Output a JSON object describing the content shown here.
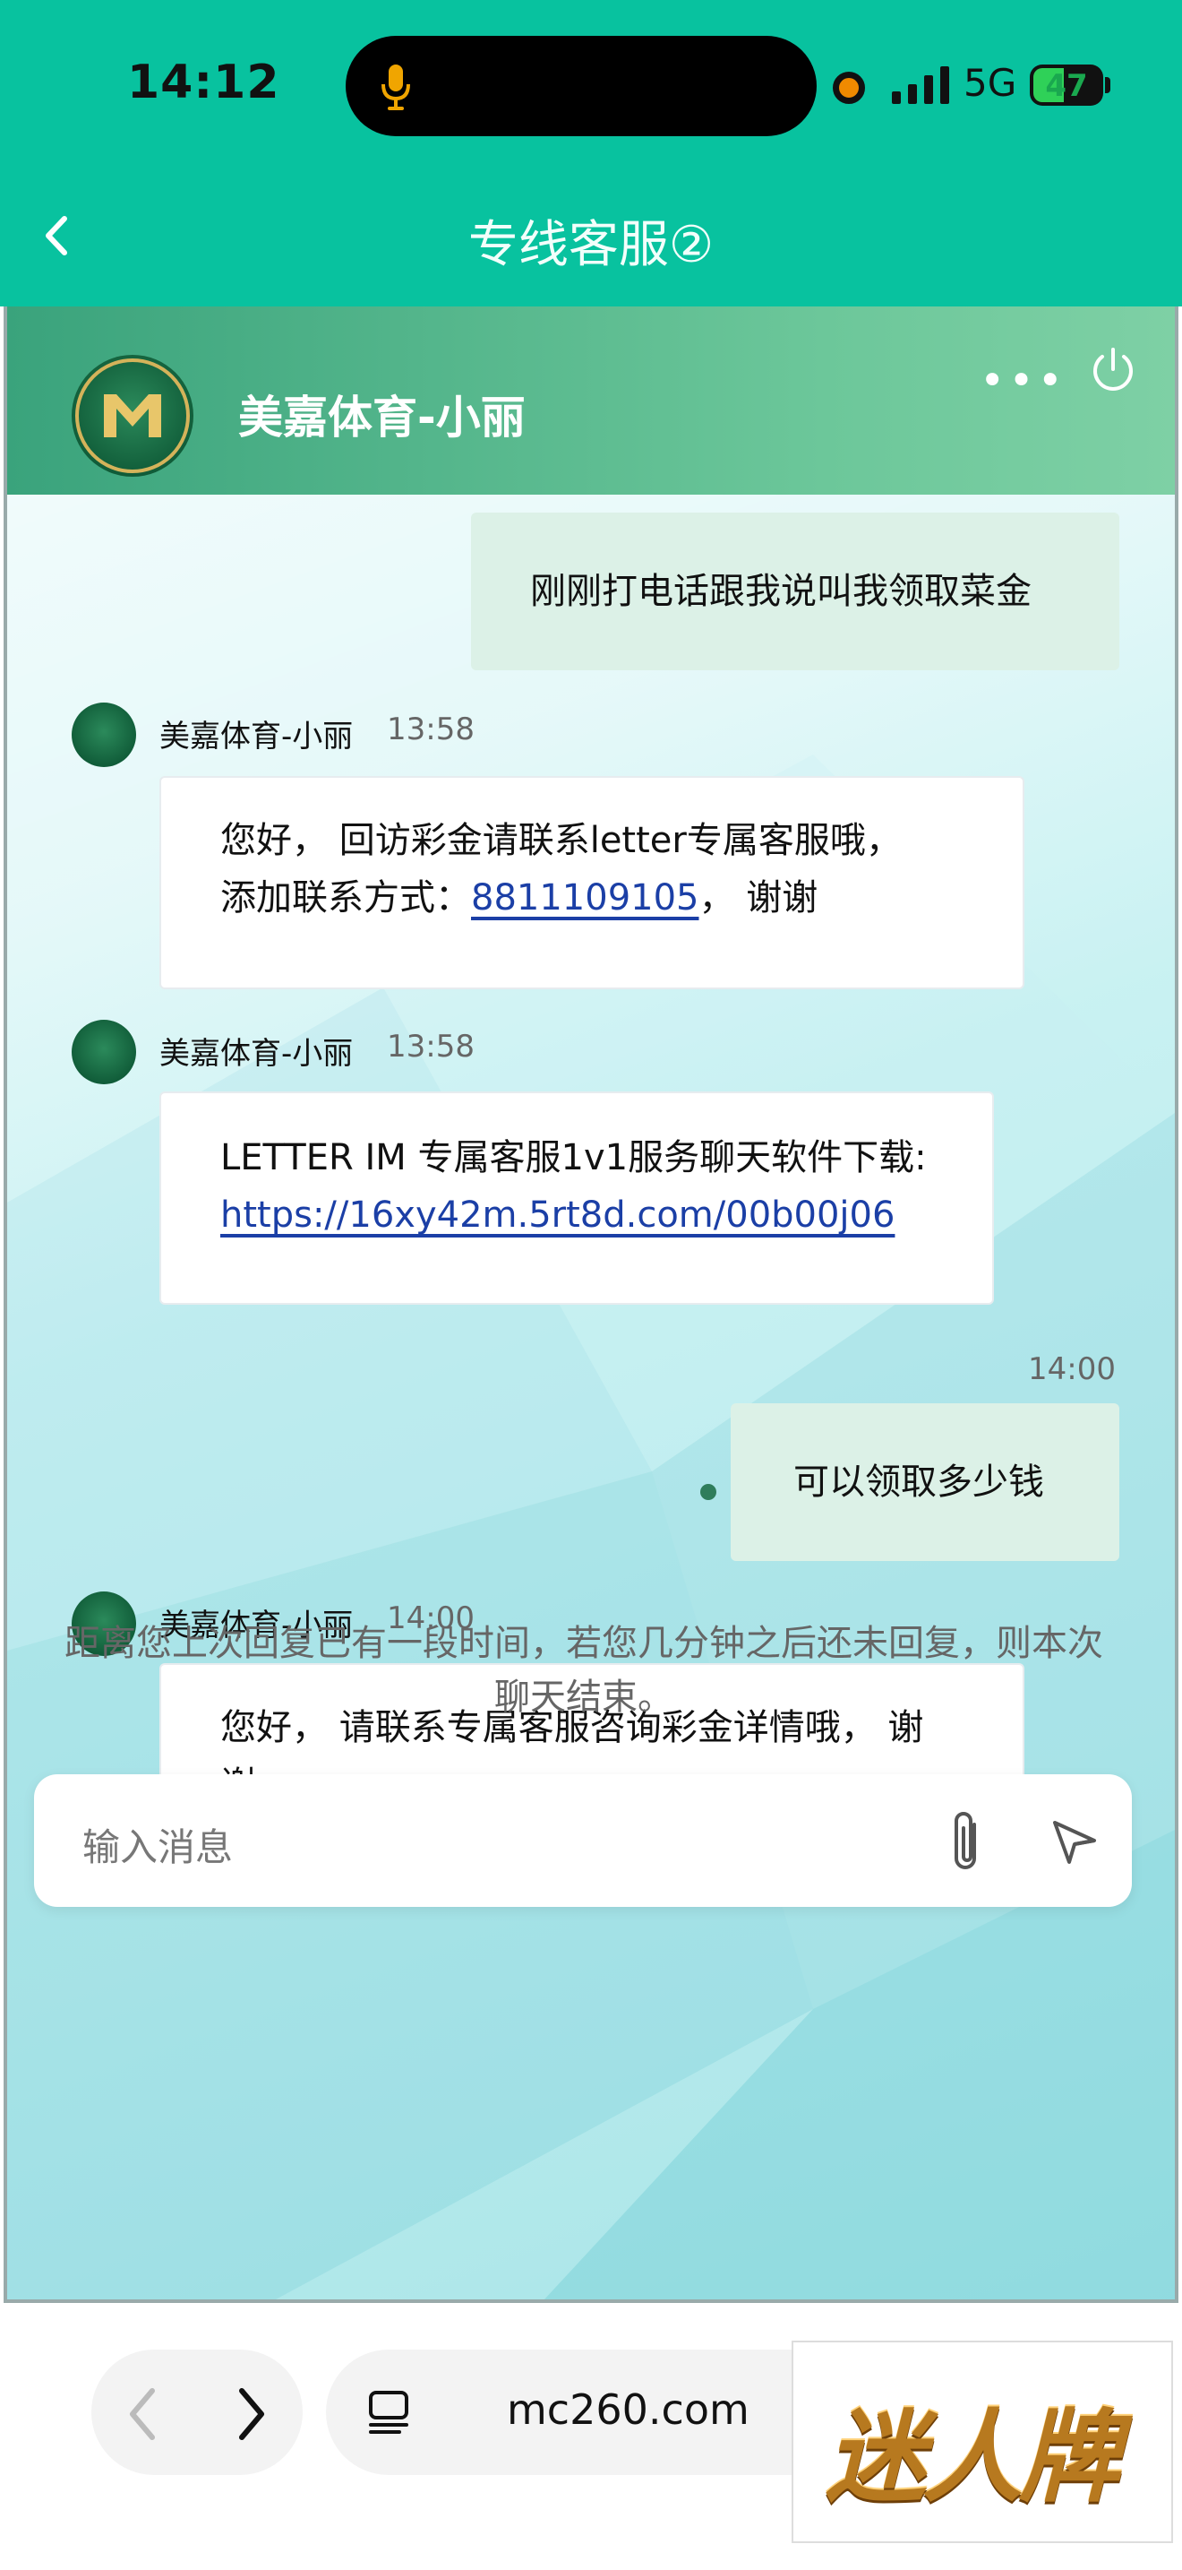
{
  "status_bar": {
    "time": "14:12",
    "network": "5G",
    "battery": "47"
  },
  "header": {
    "title": "专线客服②"
  },
  "chat_header": {
    "agent_name": "美嘉体育-小丽"
  },
  "messages": [
    {
      "type": "out",
      "text": "刚刚打电话跟我说叫我领取菜金"
    },
    {
      "type": "in",
      "sender": "美嘉体育-小丽",
      "time": "13:58",
      "line1": "您好，  回访彩金请联系letter专属客服哦，",
      "line2_prefix": "添加联系方式：",
      "link": "8811109105",
      "line2_suffix": "，  谢谢"
    },
    {
      "type": "in",
      "sender": "美嘉体育-小丽",
      "time": "13:58",
      "line1": "LETTER IM 专属客服1v1服务聊天软件下载:",
      "link": "https://16xy42m.5rt8d.com/00b00j06"
    },
    {
      "type": "out",
      "time": "14:00",
      "text": "可以领取多少钱"
    },
    {
      "type": "in",
      "sender": "美嘉体育-小丽",
      "time": "14:00",
      "line1": "您好，  请联系专属客服咨询彩金详情哦，  谢",
      "line2": "谢"
    }
  ],
  "notice": "距离您上次回复已有一段时间，若您几分钟之后还未回复，则本次聊天结束。",
  "input": {
    "placeholder": "输入消息"
  },
  "browser": {
    "url": "mc260.com",
    "ad_text": "迷人牌"
  },
  "colors": {
    "header_green": "#08c29f",
    "out_bubble": "#dcf1e7",
    "link_blue": "#1b3fa6"
  }
}
